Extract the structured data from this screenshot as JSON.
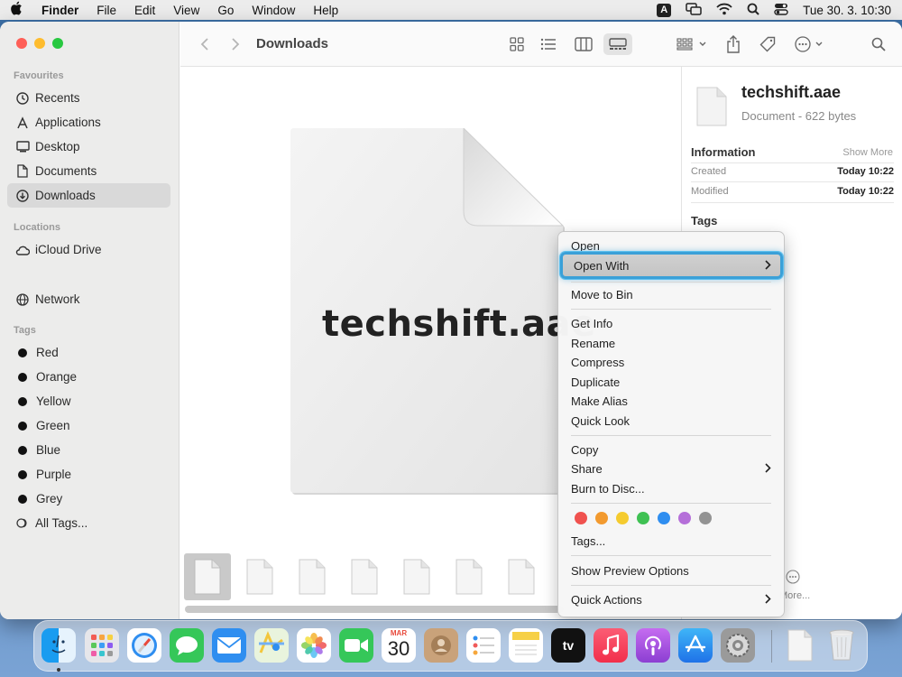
{
  "menubar": {
    "apple": "",
    "menus": [
      "Finder",
      "File",
      "Edit",
      "View",
      "Go",
      "Window",
      "Help"
    ],
    "input_indicator": "A",
    "datetime": "Tue 30. 3.  10:30"
  },
  "sidebar": {
    "favourites_heading": "Favourites",
    "favourites": [
      {
        "label": "Recents",
        "icon": "clock-icon"
      },
      {
        "label": "Applications",
        "icon": "applications-icon"
      },
      {
        "label": "Desktop",
        "icon": "desktop-icon"
      },
      {
        "label": "Documents",
        "icon": "document-icon"
      },
      {
        "label": "Downloads",
        "icon": "download-icon",
        "active": true
      }
    ],
    "locations_heading": "Locations",
    "locations": [
      {
        "label": "iCloud Drive",
        "icon": "cloud-icon"
      },
      {
        "label": "Network",
        "icon": "globe-icon"
      }
    ],
    "tags_heading": "Tags",
    "tags": [
      "Red",
      "Orange",
      "Yellow",
      "Green",
      "Blue",
      "Purple",
      "Grey"
    ],
    "all_tags": "All Tags..."
  },
  "toolbar": {
    "title": "Downloads"
  },
  "preview": {
    "file_name": "techshift.aae"
  },
  "inspector": {
    "name": "techshift.aae",
    "kind": "Document - 622 bytes",
    "info_heading": "Information",
    "show_more": "Show More",
    "created_label": "Created",
    "created_value": "Today 10:22",
    "modified_label": "Modified",
    "modified_value": "Today 10:22",
    "tags_heading": "Tags",
    "more_button": "More..."
  },
  "context_menu": {
    "open": "Open",
    "open_with": "Open With",
    "move_to_bin": "Move to Bin",
    "get_info": "Get Info",
    "rename": "Rename",
    "compress": "Compress",
    "duplicate": "Duplicate",
    "make_alias": "Make Alias",
    "quick_look": "Quick Look",
    "copy": "Copy",
    "share": "Share",
    "burn": "Burn to Disc...",
    "tags": "Tags...",
    "show_preview_options": "Show Preview Options",
    "quick_actions": "Quick Actions",
    "tag_colors": [
      "#f0524f",
      "#f29a2f",
      "#f5cb2f",
      "#3fc153",
      "#2f8ef0",
      "#b56fd9",
      "#939393"
    ]
  },
  "dock": {
    "calendar_month": "MAR",
    "calendar_day": "30",
    "tv_label": "tv"
  }
}
